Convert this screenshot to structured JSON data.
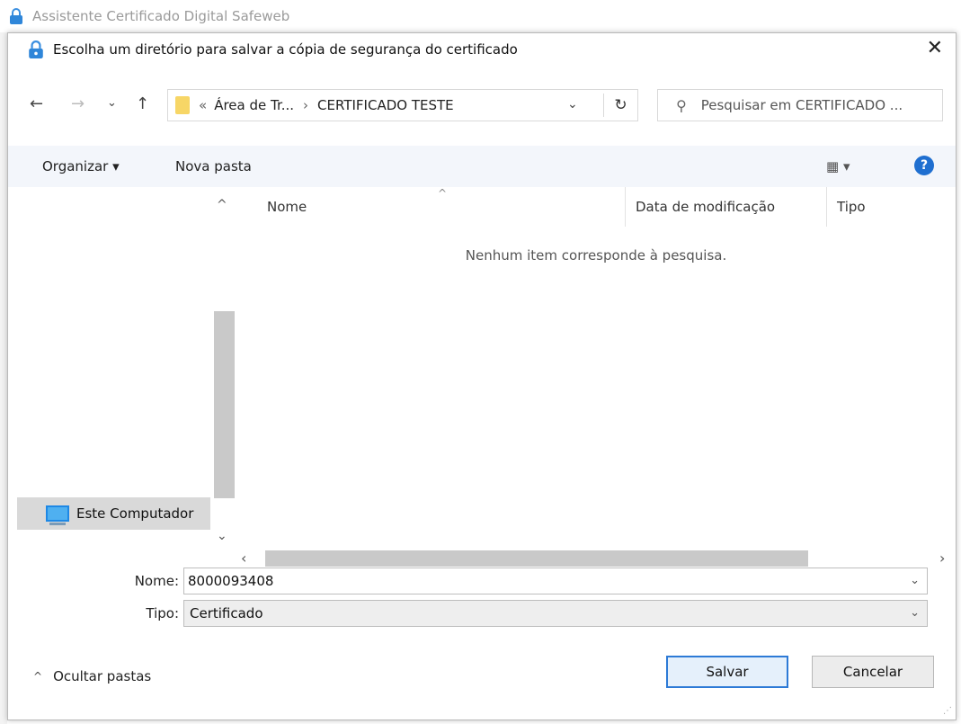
{
  "parent_window": {
    "title": "Assistente Certificado Digital Safeweb",
    "icon": "lock-icon"
  },
  "dialog": {
    "title": "Escolha um diretório para salvar a cópia de segurança do certificado",
    "icon": "lock-icon",
    "close_glyph": "✕"
  },
  "nav": {
    "back_glyph": "←",
    "forward_glyph": "→",
    "recent_glyph": "⌄",
    "up_glyph": "↑",
    "breadcrumb": {
      "overflow": "«",
      "segments": [
        "Área de Tr...",
        "CERTIFICADO TESTE"
      ],
      "separator": "›"
    },
    "dropdown_glyph": "⌄",
    "refresh_glyph": "↻",
    "search_placeholder": "Pesquisar em CERTIFICADO ...",
    "search_glyph": "⚲"
  },
  "commands": {
    "organize": "Organizar ▾",
    "new_folder": "Nova pasta",
    "view_glyph": "▦ ▾",
    "help_glyph": "?"
  },
  "left_pane": {
    "items": [
      {
        "label": "Este Computador",
        "icon": "computer-icon",
        "selected": true
      }
    ]
  },
  "file_list": {
    "columns": [
      "Nome",
      "Data de modificação",
      "Tipo"
    ],
    "sort_glyph": "^",
    "empty_message": "Nenhum item corresponde à pesquisa."
  },
  "form": {
    "name_label": "Nome:",
    "name_value": "8000093408",
    "type_label": "Tipo:",
    "type_value": "Certificado"
  },
  "footer": {
    "hide_folders": "Ocultar pastas",
    "save": "Salvar",
    "cancel": "Cancelar"
  },
  "colors": {
    "accent": "#2d7ad6",
    "help_blue": "#1f6fd0",
    "folder": "#f7d666",
    "command_bar": "#f3f6fb"
  }
}
